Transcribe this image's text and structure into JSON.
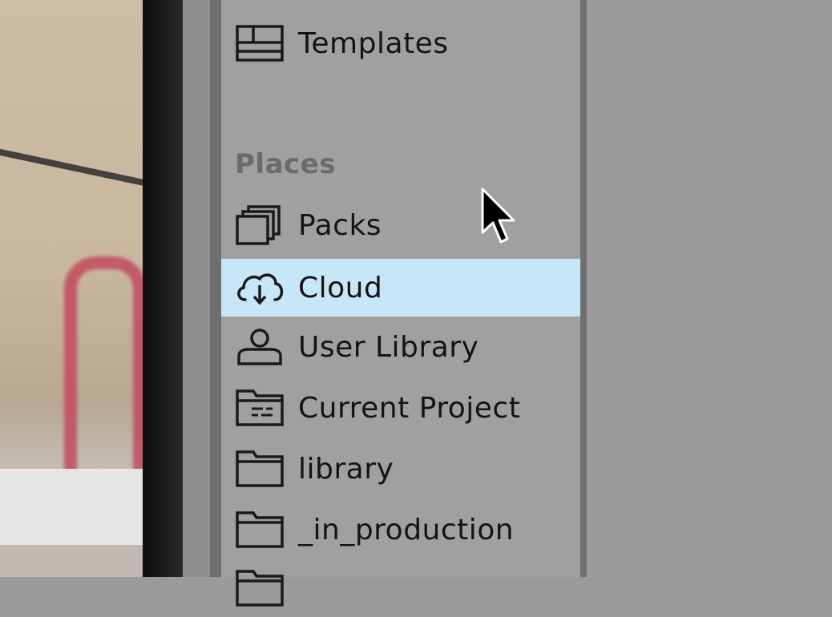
{
  "sidebar": {
    "items_top": [
      {
        "label": "Templates",
        "icon": "templates-icon"
      }
    ],
    "section_places": "Places",
    "places": [
      {
        "label": "Packs",
        "icon": "packs-icon"
      },
      {
        "label": "Cloud",
        "icon": "cloud-download-icon",
        "selected": true
      },
      {
        "label": "User Library",
        "icon": "user-icon"
      },
      {
        "label": "Current Project",
        "icon": "project-folder-icon"
      },
      {
        "label": "library",
        "icon": "folder-icon"
      },
      {
        "label": "_in_production",
        "icon": "folder-icon"
      }
    ]
  },
  "colors": {
    "sidebar_bg": "#a0a0a0",
    "selected_bg": "#c7e7f8",
    "section_label": "#6b6b6b",
    "text": "#141414"
  }
}
